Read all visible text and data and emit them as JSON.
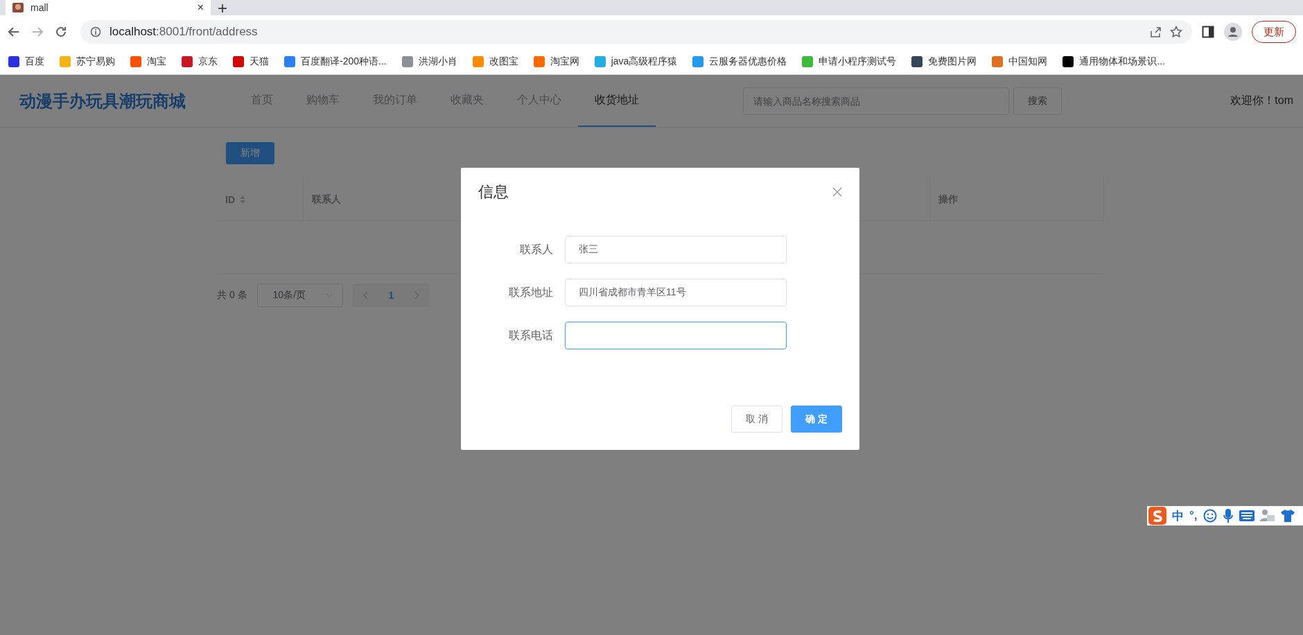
{
  "browser": {
    "tab": {
      "title": "mall",
      "close": "×"
    },
    "new_tab": "+",
    "address": {
      "host": "localhost",
      "path": ":8001/front/address"
    },
    "forward_disabled": true,
    "update_button": "更新"
  },
  "bookmarks": [
    {
      "label": "百度",
      "color": "#2932e1"
    },
    {
      "label": "苏宁易购",
      "color": "#f5b317"
    },
    {
      "label": "淘宝",
      "color": "#ff5000"
    },
    {
      "label": "京东",
      "color": "#c81623"
    },
    {
      "label": "天猫",
      "color": "#d40000"
    },
    {
      "label": "百度翻译-200种语...",
      "color": "#2b7ff0"
    },
    {
      "label": "洪湖小肖",
      "color": "#8a8f99"
    },
    {
      "label": "改图宝",
      "color": "#ff8a00"
    },
    {
      "label": "淘宝网",
      "color": "#ff6a00"
    },
    {
      "label": "java高级程序猿",
      "color": "#23ade5"
    },
    {
      "label": "云服务器优惠价格",
      "color": "#1f9bef"
    },
    {
      "label": "申请小程序测试号",
      "color": "#3dbb3b"
    },
    {
      "label": "免费图片网",
      "color": "#35465c"
    },
    {
      "label": "中国知网",
      "color": "#e06f20"
    },
    {
      "label": "通用物体和场景识...",
      "color": "#000000"
    }
  ],
  "site": {
    "title": "动漫手办玩具潮玩商城",
    "nav": [
      {
        "label": "首页",
        "selected": false
      },
      {
        "label": "购物车",
        "selected": false
      },
      {
        "label": "我的订单",
        "selected": false
      },
      {
        "label": "收藏夹",
        "selected": false
      },
      {
        "label": "个人中心",
        "selected": false
      },
      {
        "label": "收货地址",
        "selected": true
      }
    ],
    "search": {
      "placeholder": "请输入商品名称搜索商品",
      "button": "搜索"
    },
    "welcome": "欢迎你！tom"
  },
  "toolbar": {
    "add_button": "新增"
  },
  "table": {
    "columns": [
      {
        "label": "ID",
        "sortable": true
      },
      {
        "label": "联系人",
        "sortable": false
      },
      {
        "label": "操作",
        "sortable": false
      }
    ]
  },
  "pagination": {
    "total": "共 0 条",
    "page_size": "10条/页",
    "pages": [
      {
        "label": "1",
        "selected": true
      }
    ]
  },
  "dialog": {
    "title": "信息",
    "fields": [
      {
        "label": "联系人",
        "value": "张三",
        "focused": false
      },
      {
        "label": "联系地址",
        "value": "四川省成都市青羊区11号",
        "focused": false
      },
      {
        "label": "联系电话",
        "focused": true
      }
    ],
    "buttons": [
      {
        "label": "取 消",
        "kind": "default"
      },
      {
        "label": "确 定",
        "kind": "primary"
      }
    ]
  },
  "ime": {
    "mode": "中",
    "punctuation": "°,"
  }
}
